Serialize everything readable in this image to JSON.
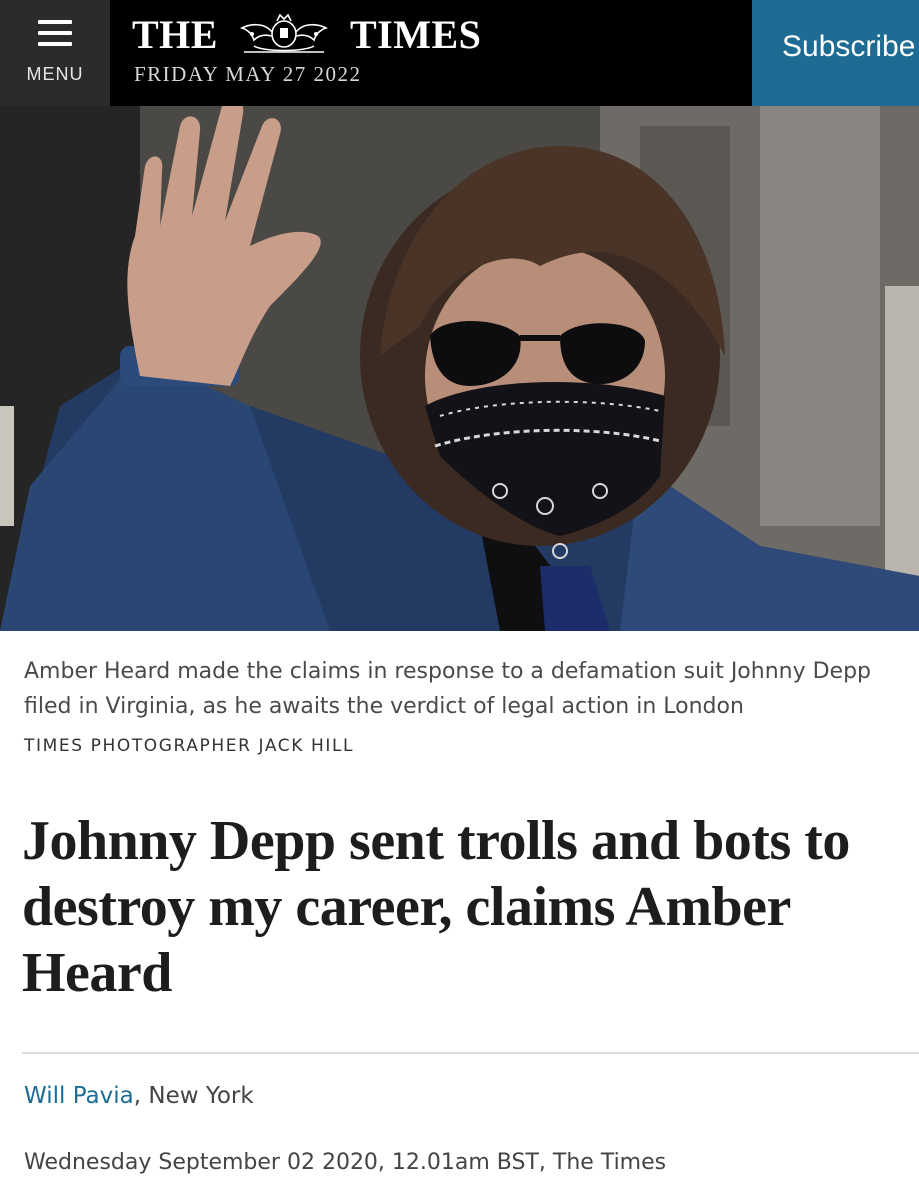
{
  "header": {
    "menu_label": "MENU",
    "masthead_left": "THE",
    "masthead_right": "TIMES",
    "date": "FRIDAY MAY 27 2022",
    "subscribe_label": "Subscribe"
  },
  "photo": {
    "caption_line1": "Amber Heard made the claims in response to a defamation suit Johnny Depp",
    "caption_line2": "filed in Virginia, as he awaits the verdict of legal action in London",
    "credit": "TIMES PHOTOGRAPHER JACK HILL"
  },
  "article": {
    "headline": "Johnny Depp sent trolls and bots to destroy my career, claims Amber Heard",
    "author": "Will Pavia",
    "location": ", New York",
    "published": "Wednesday September 02 2020, 12.01am BST, The Times"
  },
  "colors": {
    "header_bg": "#000000",
    "menu_bg": "#2b2b2b",
    "subscribe_bg": "#1e6b93",
    "link": "#1e6b93"
  },
  "icons": [
    "hamburger-menu-icon",
    "royal-crest-logo"
  ]
}
